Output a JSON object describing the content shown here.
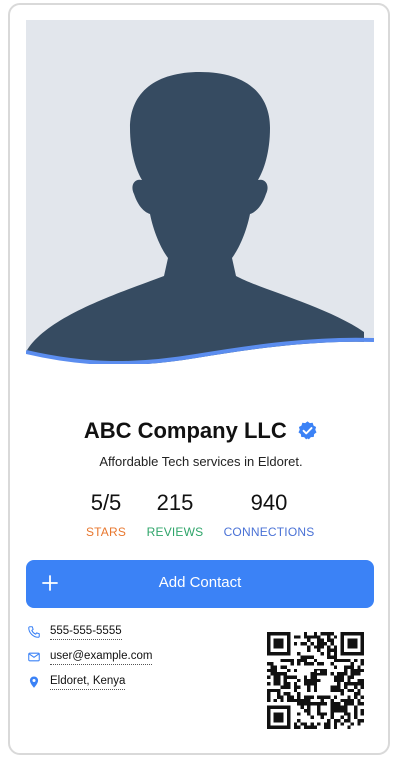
{
  "profile": {
    "name": "ABC Company LLC",
    "tagline": "Affordable Tech services in Eldoret."
  },
  "stats": [
    {
      "value": "5/5",
      "label": "STARS",
      "color": "#e8772e"
    },
    {
      "value": "215",
      "label": "REVIEWS",
      "color": "#2fa56a"
    },
    {
      "value": "940",
      "label": "CONNECTIONS",
      "color": "#4a72d6"
    }
  ],
  "actions": {
    "add_contact_label": "Add Contact"
  },
  "contact": {
    "phone": "555-555-5555",
    "email": "user@example.com",
    "location": "Eldoret, Kenya"
  },
  "colors": {
    "accent": "#3b82f6",
    "avatar_bg": "#e2e6ec",
    "avatar_fg": "#364b61"
  },
  "icons": [
    "verified-badge-icon",
    "plus-icon",
    "phone-icon",
    "mail-icon",
    "location-pin-icon",
    "qr-code"
  ]
}
